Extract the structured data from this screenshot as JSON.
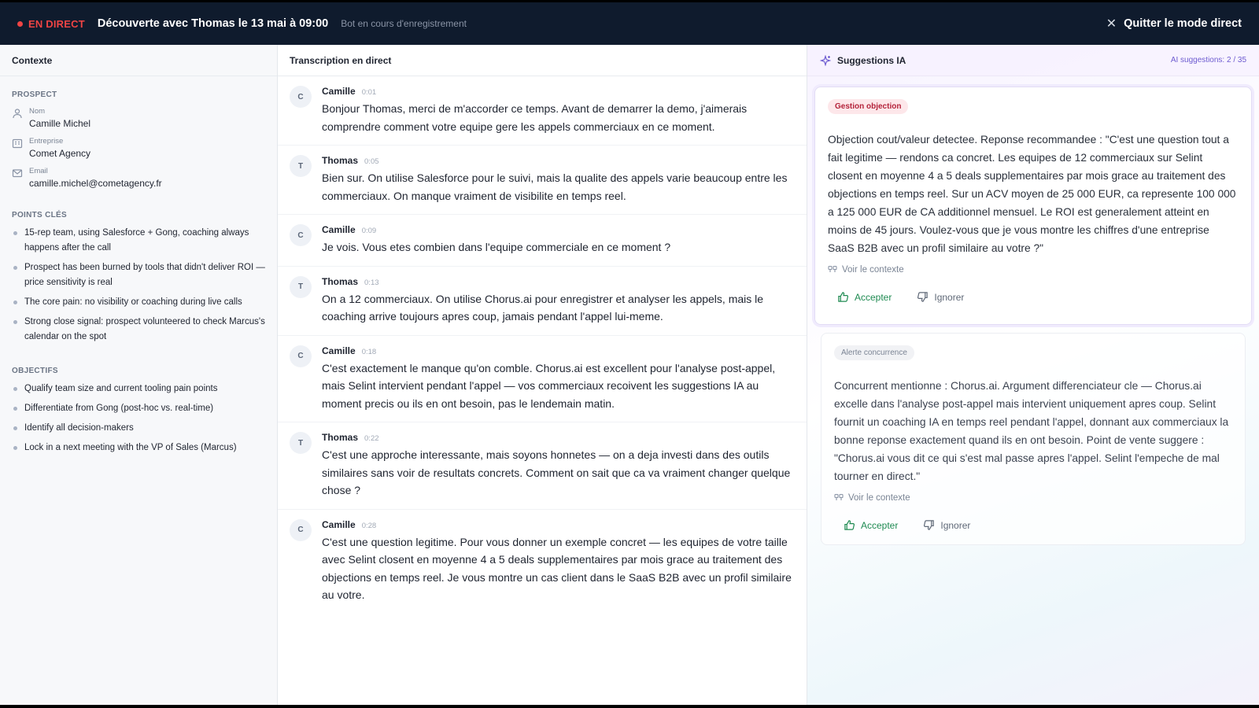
{
  "topbar": {
    "live_label": "EN DIRECT",
    "meeting_title": "Découverte avec Thomas le 13 mai à 09:00",
    "bot_status": "Bot en cours d'enregistrement",
    "quit_label": "Quitter le mode direct",
    "live_color": "#ef4444"
  },
  "context": {
    "title": "Contexte",
    "prospect_label": "PROSPECT",
    "fields": [
      {
        "icon": "user-icon",
        "label": "Nom",
        "value": "Camille Michel"
      },
      {
        "icon": "building-icon",
        "label": "Entreprise",
        "value": "Comet Agency"
      },
      {
        "icon": "mail-icon",
        "label": "Email",
        "value": "camille.michel@cometagency.fr"
      }
    ],
    "key_points_label": "POINTS CLÉS",
    "key_points": [
      "15-rep team, using Salesforce + Gong, coaching always happens after the call",
      "Prospect has been burned by tools that didn't deliver ROI — price sensitivity is real",
      "The core pain: no visibility or coaching during live calls",
      "Strong close signal: prospect volunteered to check Marcus's calendar on the spot"
    ],
    "objectives_label": "OBJECTIFS",
    "objectives": [
      "Qualify team size and current tooling pain points",
      "Differentiate from Gong (post-hoc vs. real-time)",
      "Identify all decision-makers",
      "Lock in a next meeting with the VP of Sales (Marcus)"
    ]
  },
  "transcript": {
    "title": "Transcription en direct",
    "messages": [
      {
        "initial": "C",
        "speaker": "Camille",
        "time": "0:01",
        "text": "Bonjour Thomas, merci de m'accorder ce temps. Avant de demarrer la demo, j'aimerais comprendre comment votre equipe gere les appels commerciaux en ce moment."
      },
      {
        "initial": "T",
        "speaker": "Thomas",
        "time": "0:05",
        "text": "Bien sur. On utilise Salesforce pour le suivi, mais la qualite des appels varie beaucoup entre les commerciaux. On manque vraiment de visibilite en temps reel."
      },
      {
        "initial": "C",
        "speaker": "Camille",
        "time": "0:09",
        "text": "Je vois. Vous etes combien dans l'equipe commerciale en ce moment ?"
      },
      {
        "initial": "T",
        "speaker": "Thomas",
        "time": "0:13",
        "text": "On a 12 commerciaux. On utilise Chorus.ai pour enregistrer et analyser les appels, mais le coaching arrive toujours apres coup, jamais pendant l'appel lui-meme."
      },
      {
        "initial": "C",
        "speaker": "Camille",
        "time": "0:18",
        "text": "C'est exactement le manque qu'on comble. Chorus.ai est excellent pour l'analyse post-appel, mais Selint intervient pendant l'appel — vos commerciaux recoivent les suggestions IA au moment precis ou ils en ont besoin, pas le lendemain matin."
      },
      {
        "initial": "T",
        "speaker": "Thomas",
        "time": "0:22",
        "text": "C'est une approche interessante, mais soyons honnetes — on a deja investi dans des outils similaires sans voir de resultats concrets. Comment on sait que ca va vraiment changer quelque chose ?"
      },
      {
        "initial": "C",
        "speaker": "Camille",
        "time": "0:28",
        "text": "C'est une question legitime. Pour vous donner un exemple concret — les equipes de votre taille avec Selint closent en moyenne 4 a 5 deals supplementaires par mois grace au traitement des objections en temps reel. Je vous montre un cas client dans le SaaS B2B avec un profil similaire au votre."
      }
    ]
  },
  "suggestions": {
    "title": "Suggestions IA",
    "count": "AI suggestions: 2 / 35",
    "cards": [
      {
        "badge": "Gestion objection",
        "text": "Objection cout/valeur detectee. Reponse recommandee : \"C'est une question tout a fait legitime — rendons ca concret. Les equipes de 12 commerciaux sur Selint closent en moyenne 4 a 5 deals supplementaires par mois grace au traitement des objections en temps reel. Sur un ACV moyen de 25 000 EUR, ca represente 100 000 a 125 000 EUR de CA additionnel mensuel. Le ROI est generalement atteint en moins de 45 jours. Voulez-vous que je vous montre les chiffres d'une entreprise SaaS B2B avec un profil similaire au votre ?\"",
        "context_link": "Voir le contexte",
        "accept": "Accepter",
        "ignore": "Ignorer"
      },
      {
        "badge": "Alerte concurrence",
        "text": "Concurrent mentionne : Chorus.ai. Argument differenciateur cle — Chorus.ai excelle dans l'analyse post-appel mais intervient uniquement apres coup. Selint fournit un coaching IA en temps reel pendant l'appel, donnant aux commerciaux la bonne reponse exactement quand ils en ont besoin. Point de vente suggere : \"Chorus.ai vous dit ce qui s'est mal passe apres l'appel. Selint l'empeche de mal tourner en direct.\"",
        "context_link": "Voir le contexte",
        "accept": "Accepter",
        "ignore": "Ignorer"
      }
    ],
    "accent_color": "#6d5bd0",
    "accept_color": "#1e8a51"
  }
}
